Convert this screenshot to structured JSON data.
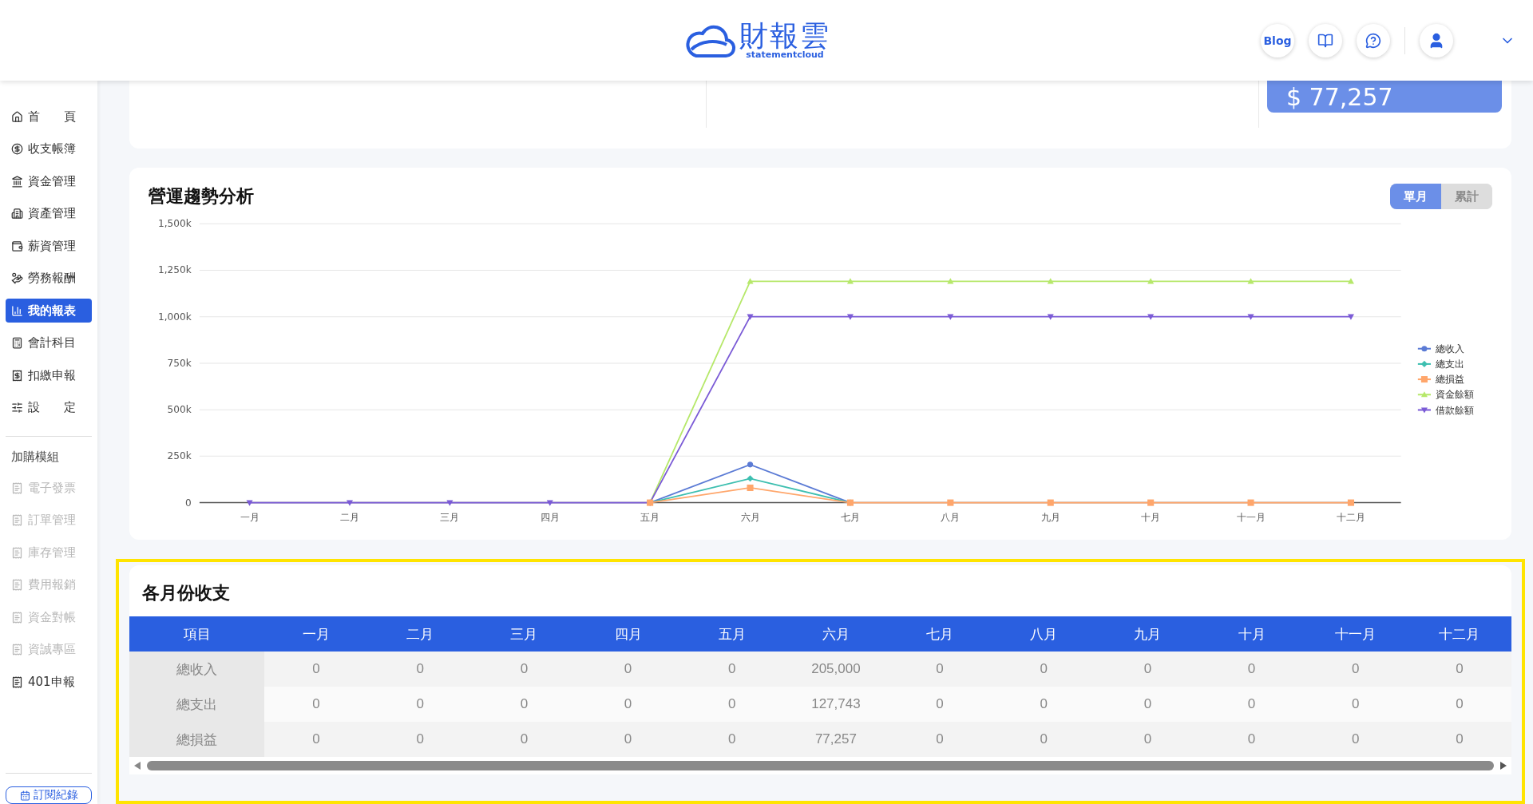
{
  "header": {
    "logo": {
      "name": "財報雲",
      "tagline": "statementcloud"
    },
    "blog_button": "Blog"
  },
  "sidebar": {
    "items": [
      {
        "label": "首　　頁",
        "selected": false
      },
      {
        "label": "收支帳簿",
        "selected": false
      },
      {
        "label": "資金管理",
        "selected": false
      },
      {
        "label": "資產管理",
        "selected": false
      },
      {
        "label": "薪資管理",
        "selected": false
      },
      {
        "label": "勞務報酬",
        "selected": false
      },
      {
        "label": "我的報表",
        "selected": true
      },
      {
        "label": "會計科目",
        "selected": false
      },
      {
        "label": "扣繳申報",
        "selected": false
      },
      {
        "label": "設　　定",
        "selected": false
      }
    ],
    "addons_heading": "加購模組",
    "addons": [
      {
        "label": "電子發票",
        "disabled": true
      },
      {
        "label": "訂單管理",
        "disabled": true
      },
      {
        "label": "庫存管理",
        "disabled": true
      },
      {
        "label": "費用報銷",
        "disabled": true
      },
      {
        "label": "資金對帳",
        "disabled": true
      },
      {
        "label": "資誠專區",
        "disabled": true
      },
      {
        "label": "401申報",
        "disabled": false
      }
    ],
    "subscribe_button": "訂閱紀錄"
  },
  "summary": {
    "amount": "$ 77,257"
  },
  "trend": {
    "title": "營運趨勢分析",
    "toggle": [
      {
        "label": "單月",
        "selected": true
      },
      {
        "label": "累計",
        "selected": false
      }
    ],
    "chart_data": {
      "type": "line",
      "categories": [
        "一月",
        "二月",
        "三月",
        "四月",
        "五月",
        "六月",
        "七月",
        "八月",
        "九月",
        "十月",
        "十一月",
        "十二月"
      ],
      "grid": true,
      "legend": true,
      "series": [
        {
          "name": "總收入",
          "color": "#5b7bd5",
          "marker": "circle",
          "values": [
            null,
            null,
            null,
            null,
            0,
            205000,
            0,
            null,
            null,
            null,
            null,
            null
          ]
        },
        {
          "name": "總支出",
          "color": "#3dbfb0",
          "marker": "diamond",
          "values": [
            null,
            null,
            null,
            null,
            0,
            130000,
            0,
            null,
            null,
            null,
            null,
            null
          ]
        },
        {
          "name": "總損益",
          "color": "#ffa66b",
          "marker": "square",
          "values": [
            null,
            null,
            null,
            null,
            0,
            80000,
            0,
            0,
            0,
            0,
            0,
            0
          ]
        },
        {
          "name": "資金餘額",
          "color": "#b6e86a",
          "marker": "triangle",
          "values": [
            null,
            null,
            null,
            null,
            0,
            1190000,
            1190000,
            1190000,
            1190000,
            1190000,
            1190000,
            1190000
          ]
        },
        {
          "name": "借款餘額",
          "color": "#7b5bd6",
          "marker": "triangle-down",
          "values": [
            0,
            0,
            0,
            0,
            0,
            1000000,
            1000000,
            1000000,
            1000000,
            1000000,
            1000000,
            1000000
          ]
        }
      ],
      "ylim": [
        0,
        1500000
      ],
      "yticks": [
        {
          "value": 0,
          "label": "0"
        },
        {
          "value": 250000,
          "label": "250k"
        },
        {
          "value": 500000,
          "label": "500k"
        },
        {
          "value": 750000,
          "label": "750k"
        },
        {
          "value": 1000000,
          "label": "1,000k"
        },
        {
          "value": 1250000,
          "label": "1,250k"
        },
        {
          "value": 1500000,
          "label": "1,500k"
        }
      ]
    }
  },
  "monthly": {
    "title": "各月份收支",
    "columns": [
      "項目",
      "一月",
      "二月",
      "三月",
      "四月",
      "五月",
      "六月",
      "七月",
      "八月",
      "九月",
      "十月",
      "十一月",
      "十二月"
    ],
    "rows": [
      {
        "label": "總收入",
        "values": [
          "0",
          "0",
          "0",
          "0",
          "0",
          "205,000",
          "0",
          "0",
          "0",
          "0",
          "0",
          "0"
        ]
      },
      {
        "label": "總支出",
        "values": [
          "0",
          "0",
          "0",
          "0",
          "0",
          "127,743",
          "0",
          "0",
          "0",
          "0",
          "0",
          "0"
        ]
      },
      {
        "label": "總損益",
        "values": [
          "0",
          "0",
          "0",
          "0",
          "0",
          "77,257",
          "0",
          "0",
          "0",
          "0",
          "0",
          "0"
        ]
      }
    ]
  }
}
